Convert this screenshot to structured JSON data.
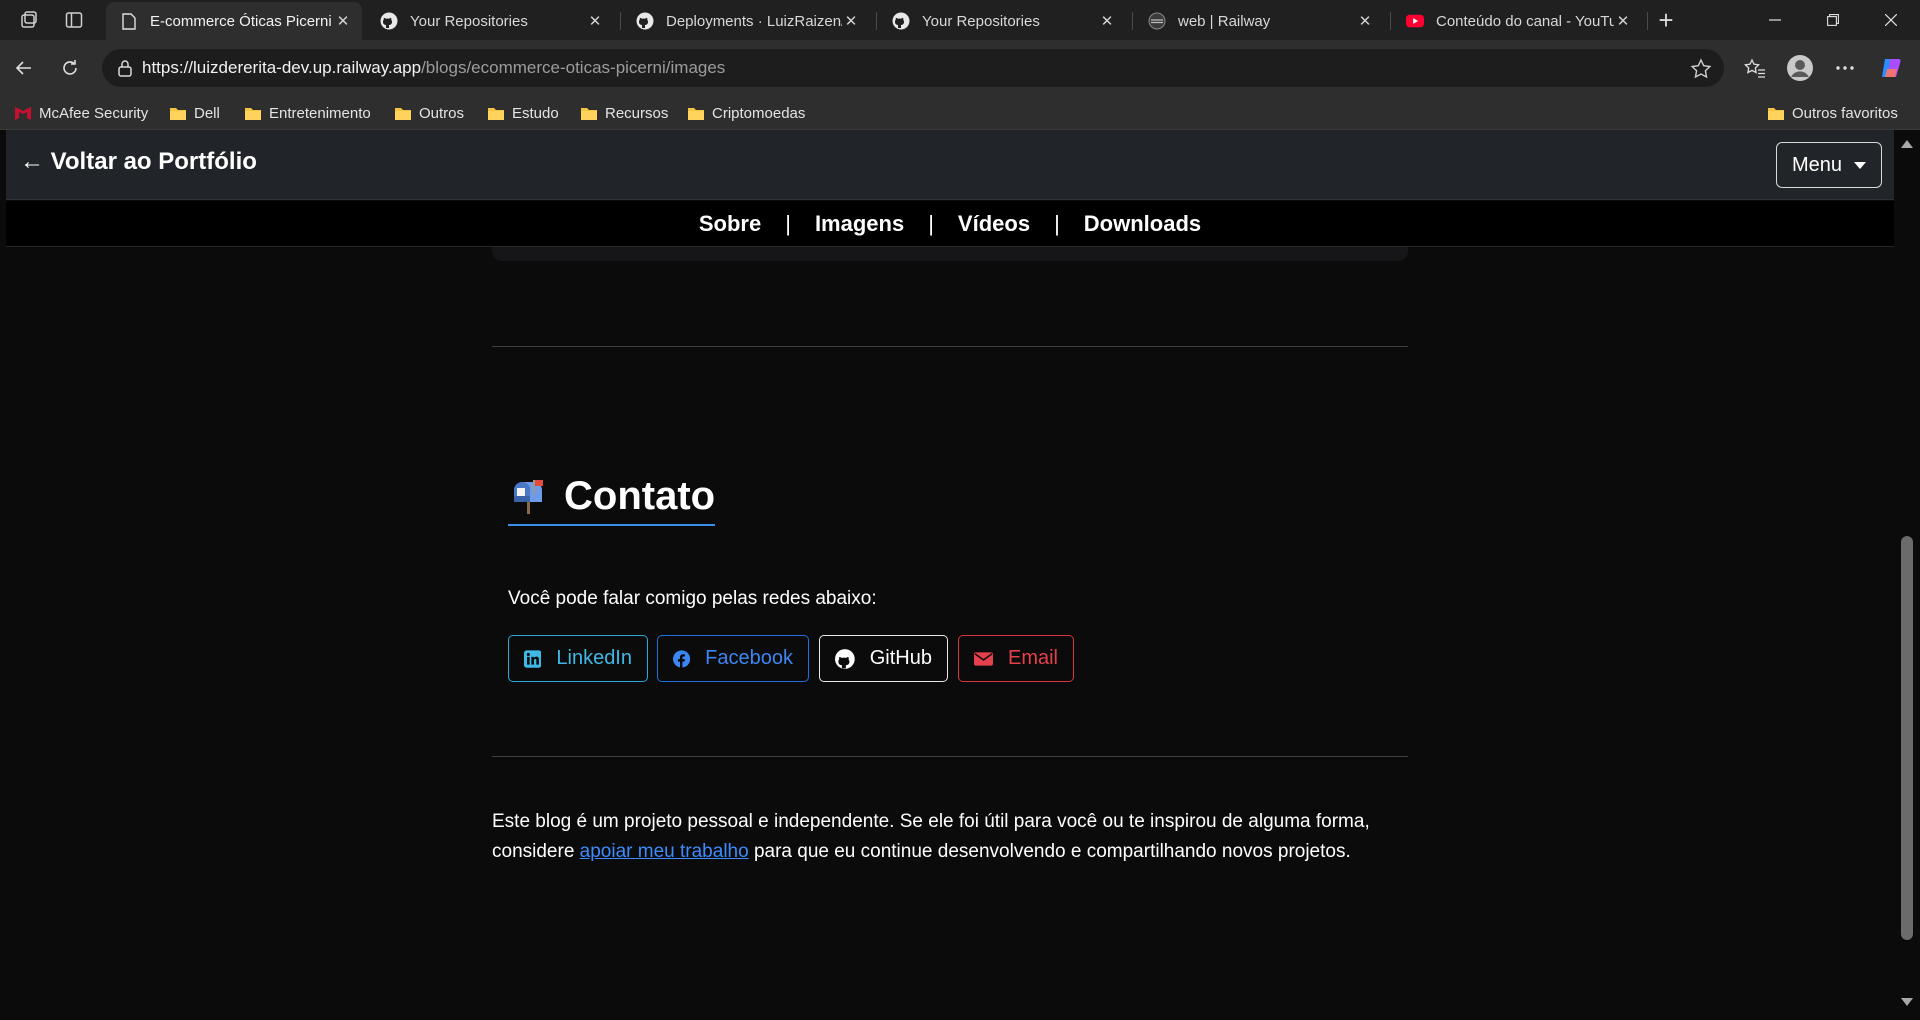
{
  "browser": {
    "tabs": [
      {
        "title": "E-commerce Óticas Picerni",
        "icon": "page-icon",
        "active": true
      },
      {
        "title": "Your Repositories",
        "icon": "github-icon",
        "active": false
      },
      {
        "title": "Deployments · LuizRaizen/p",
        "icon": "github-icon",
        "active": false
      },
      {
        "title": "Your Repositories",
        "icon": "github-icon",
        "active": false
      },
      {
        "title": "web | Railway",
        "icon": "railway-icon",
        "active": false
      },
      {
        "title": "Conteúdo do canal - YouTu",
        "icon": "youtube-icon",
        "active": false
      }
    ],
    "close_glyph": "✕",
    "new_tab_glyph": "+",
    "url_host": "https://luizdererita-dev.up.railway.app",
    "url_path": "/blogs/ecommerce-oticas-picerni/images",
    "bookmarks": [
      {
        "label": "McAfee Security",
        "icon": "mcafee-icon"
      },
      {
        "label": "Dell",
        "icon": "folder-icon"
      },
      {
        "label": "Entretenimento",
        "icon": "folder-icon"
      },
      {
        "label": "Outros",
        "icon": "folder-icon"
      },
      {
        "label": "Estudo",
        "icon": "folder-icon"
      },
      {
        "label": "Recursos",
        "icon": "folder-icon"
      },
      {
        "label": "Criptomoedas",
        "icon": "folder-icon"
      }
    ],
    "other_favorites": "Outros favoritos"
  },
  "page": {
    "brand": "← Voltar ao Portfólio",
    "menu_label": "Menu",
    "subnav": [
      "Sobre",
      "Imagens",
      "Vídeos",
      "Downloads"
    ],
    "subnav_separator": "|",
    "contact": {
      "title": "Contato",
      "intro": "Você pode falar comigo pelas redes abaixo:",
      "buttons": [
        {
          "label": "LinkedIn",
          "icon": "linkedin-icon",
          "color": "#3fb8e6"
        },
        {
          "label": "Facebook",
          "icon": "facebook-icon",
          "color": "#3b86f0"
        },
        {
          "label": "GitHub",
          "icon": "github-icon",
          "color": "#ffffff"
        },
        {
          "label": "Email",
          "icon": "envelope-icon",
          "color": "#e5404b"
        }
      ]
    },
    "footer": {
      "before": "Este blog é um projeto pessoal e independente. Se ele foi útil para você ou te inspirou de alguma forma, considere ",
      "link": "apoiar meu trabalho",
      "after": " para que eu continue desenvolvendo e compartilhando novos projetos."
    }
  },
  "colors": {
    "page_bg": "#0b0b0c",
    "navbar_bg": "#212529",
    "link_blue": "#3d8bfd",
    "title_underline": "#3a8ee6"
  }
}
